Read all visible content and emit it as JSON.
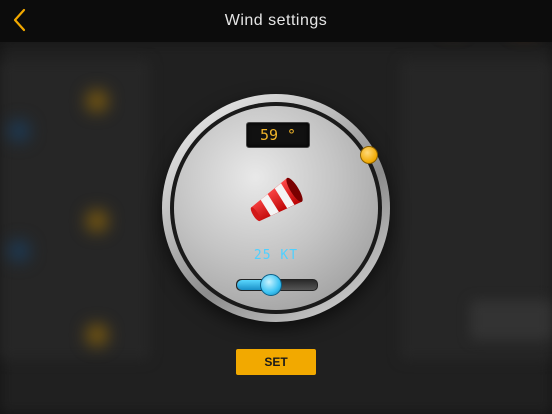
{
  "header": {
    "title": "Wind settings",
    "back_icon": "chevron-left-icon"
  },
  "dial": {
    "direction_label": "59 °",
    "direction_degrees": 59,
    "speed_label": "25 KT",
    "speed_fraction": 0.42,
    "icon": "windsock-icon"
  },
  "actions": {
    "set_label": "SET"
  },
  "colors": {
    "accent": "#f2a900",
    "speed": "#4fd0ff",
    "readout": "#f0b429"
  }
}
